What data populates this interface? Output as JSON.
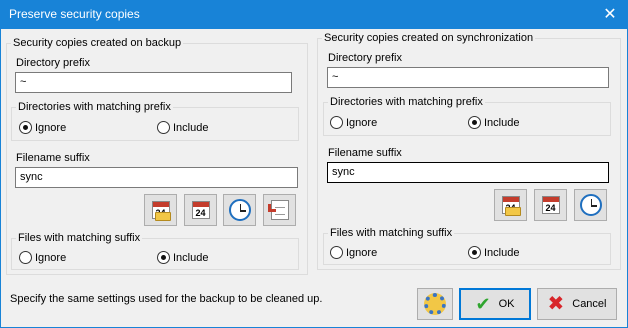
{
  "window": {
    "title": "Preserve security copies",
    "close_glyph": "✕"
  },
  "backup": {
    "title": "Security copies created on backup",
    "dir_prefix_label": "Directory prefix",
    "dir_prefix_value": "~",
    "dir_group_title": "Directories with matching prefix",
    "dir_ignore": "Ignore",
    "dir_include": "Include",
    "dir_selected": "Ignore",
    "file_suffix_label": "Filename suffix",
    "file_suffix_value": "sync",
    "file_group_title": "Files with matching suffix",
    "file_ignore": "Ignore",
    "file_include": "Include",
    "file_selected": "Include",
    "buttons": [
      {
        "icon": "calendar-folder-icon",
        "day": "24"
      },
      {
        "icon": "calendar-icon",
        "day": "24"
      },
      {
        "icon": "clock-icon"
      },
      {
        "icon": "document-arrow-icon"
      }
    ]
  },
  "sync": {
    "title": "Security copies created on synchronization",
    "dir_prefix_label": "Directory prefix",
    "dir_prefix_value": "~",
    "dir_group_title": "Directories with matching prefix",
    "dir_ignore": "Ignore",
    "dir_include": "Include",
    "dir_selected": "Include",
    "file_suffix_label": "Filename suffix",
    "file_suffix_value": "sync",
    "file_group_title": "Files with matching suffix",
    "file_ignore": "Ignore",
    "file_include": "Include",
    "file_selected": "Include",
    "buttons": [
      {
        "icon": "calendar-folder-icon",
        "day": "24"
      },
      {
        "icon": "calendar-icon",
        "day": "24"
      },
      {
        "icon": "clock-icon"
      }
    ]
  },
  "footer": {
    "note": "Specify the same settings used for the backup to be cleaned up.",
    "settings_icon": "gear-icon",
    "ok_label": "OK",
    "cancel_label": "Cancel"
  }
}
